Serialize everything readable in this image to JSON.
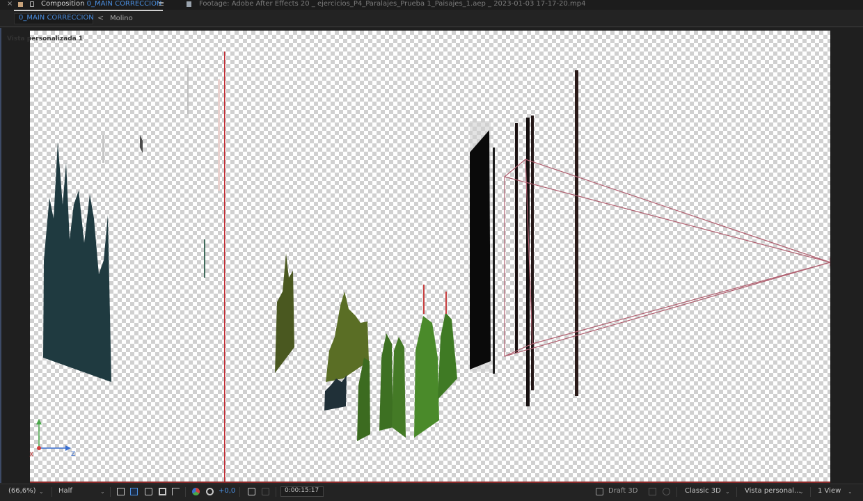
{
  "top_bar": {
    "close": "×",
    "composition_prefix": "Composition",
    "composition_name": "0_MAIN CORRECCION",
    "menu": "≡",
    "footage_title": "Footage: Adobe After Effects 20 _ ejercicios_P4_Paralajes_Prueba 1_Paisajes_1.aep _ 2023-01-03 17-17-20.mp4"
  },
  "tabs": {
    "active": "0_MAIN CORRECCION",
    "chevron": "<",
    "next": "Molino"
  },
  "viewer": {
    "view_name": "Vista personalizada 1",
    "axes": {
      "y": "Y",
      "x": "X",
      "z": "Z"
    }
  },
  "bottom_bar": {
    "zoom": "(66,6%)",
    "resolution": "Half",
    "exposure": "+0,0",
    "timecode": "0:00:15:17",
    "renderer_mode": "Draft 3D",
    "renderer": "Classic 3D",
    "view": "Vista personal...",
    "layout": "1 View"
  },
  "colors": {
    "accent": "#4b8fe0",
    "camera_lines": "#b06070",
    "ruler_red": "#c0282f",
    "exposure_blue": "#4b8fe0"
  }
}
